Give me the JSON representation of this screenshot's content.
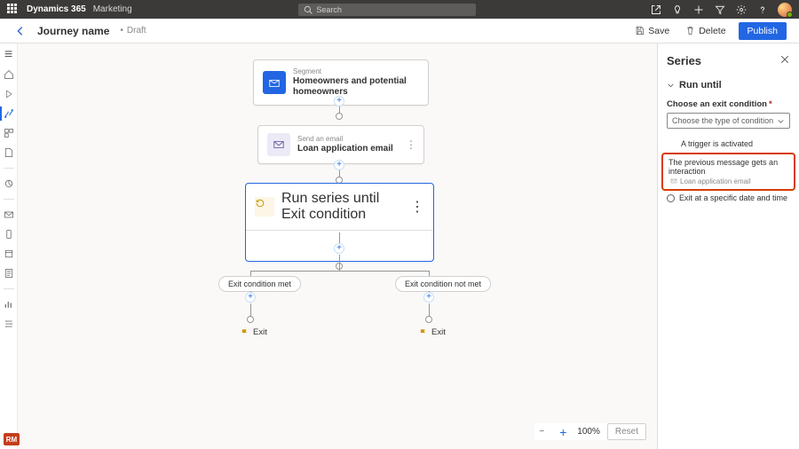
{
  "top": {
    "brand": "Dynamics 365",
    "area": "Marketing",
    "search_placeholder": "Search"
  },
  "cmd": {
    "title": "Journey name",
    "status": "Draft",
    "save": "Save",
    "delete": "Delete",
    "publish": "Publish"
  },
  "nodes": {
    "segment": {
      "label": "Segment",
      "value": "Homeowners and potential homeowners",
      "tile_color": "#2266e3"
    },
    "email": {
      "label": "Send an email",
      "value": "Loan application email",
      "tile_color": "#eaeaf7"
    },
    "series": {
      "label": "Run series until",
      "value": "Exit condition"
    },
    "branch_left": "Exit condition met",
    "branch_right": "Exit condition not met",
    "exit": "Exit"
  },
  "panel": {
    "title": "Series",
    "section": "Run until",
    "choose_label": "Choose an exit condition",
    "select_placeholder": "Choose the type of condition",
    "opt_trigger": "A trigger is activated",
    "highlight_main": "The previous message gets an interaction",
    "highlight_sub": "Loan application email",
    "radio_time": "Exit at a specific date and time"
  },
  "zoom": {
    "level": "100%",
    "reset": "Reset"
  },
  "badge": "RM"
}
